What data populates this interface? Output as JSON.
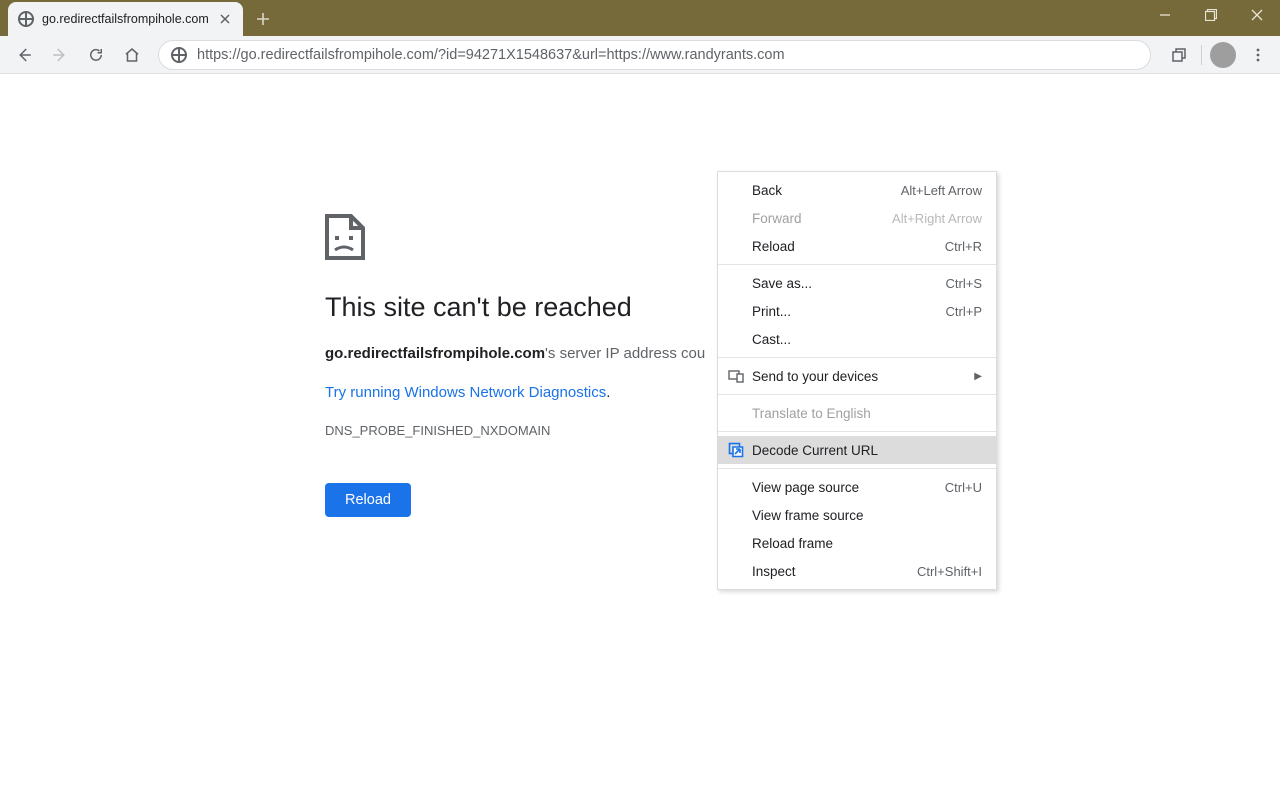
{
  "window": {
    "tab_title": "go.redirectfailsfrompihole.com",
    "url": "https://go.redirectfailsfrompihole.com/?id=94271X1548637&url=https://www.randyrants.com"
  },
  "error_page": {
    "heading": "This site can't be reached",
    "domain_bold": "go.redirectfailsfrompihole.com",
    "msg_suffix": "'s server IP address cou",
    "diag_link": "Try running Windows Network Diagnostics",
    "diag_link_dot": ".",
    "code": "DNS_PROBE_FINISHED_NXDOMAIN",
    "reload_btn": "Reload"
  },
  "context_menu": {
    "items": [
      {
        "label": "Back",
        "accel": "Alt+Left Arrow",
        "enabled": true
      },
      {
        "label": "Forward",
        "accel": "Alt+Right Arrow",
        "enabled": false
      },
      {
        "label": "Reload",
        "accel": "Ctrl+R",
        "enabled": true
      },
      {
        "sep": true
      },
      {
        "label": "Save as...",
        "accel": "Ctrl+S",
        "enabled": true
      },
      {
        "label": "Print...",
        "accel": "Ctrl+P",
        "enabled": true
      },
      {
        "label": "Cast...",
        "accel": "",
        "enabled": true
      },
      {
        "sep": true
      },
      {
        "label": "Send to your devices",
        "accel": "",
        "enabled": true,
        "icon": "devices",
        "submenu": true
      },
      {
        "sep": true
      },
      {
        "label": "Translate to English",
        "accel": "",
        "enabled": false
      },
      {
        "sep": true
      },
      {
        "label": "Decode Current URL",
        "accel": "",
        "enabled": true,
        "icon": "decode",
        "hover": true
      },
      {
        "sep": true
      },
      {
        "label": "View page source",
        "accel": "Ctrl+U",
        "enabled": true
      },
      {
        "label": "View frame source",
        "accel": "",
        "enabled": true
      },
      {
        "label": "Reload frame",
        "accel": "",
        "enabled": true
      },
      {
        "label": "Inspect",
        "accel": "Ctrl+Shift+I",
        "enabled": true
      }
    ]
  }
}
